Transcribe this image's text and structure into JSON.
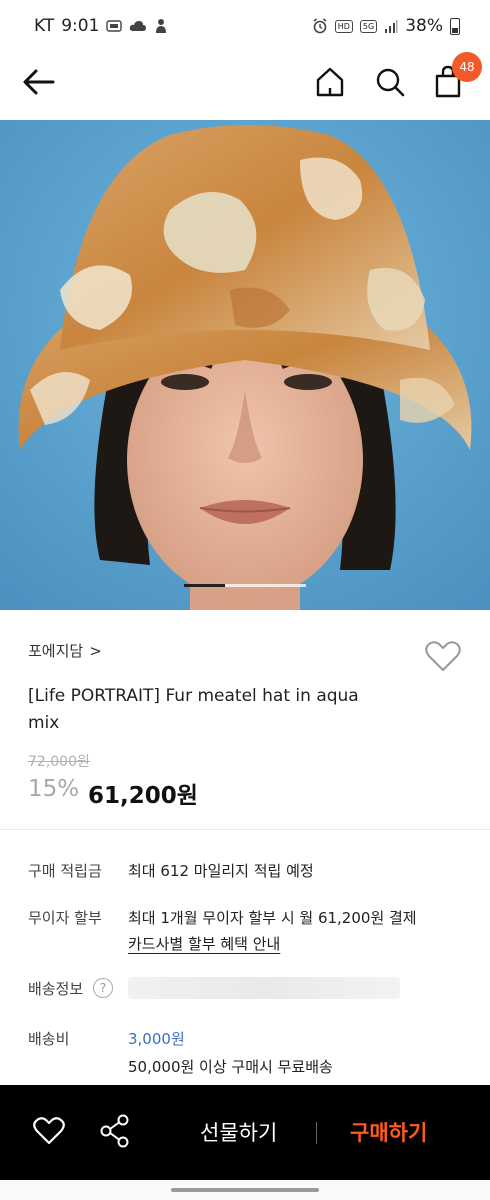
{
  "status_bar": {
    "carrier": "KT",
    "time": "9:01",
    "network": "5G",
    "hd_badge": "HD",
    "battery": "38%"
  },
  "header": {
    "cart_count": "48",
    "icons": [
      "back-arrow-icon",
      "home-icon",
      "search-icon",
      "shopping-bag-icon"
    ]
  },
  "product": {
    "image": "fur-bucket-hat-model-photo",
    "slide_position": 1,
    "slide_count": 3,
    "brand": "포에지담",
    "brand_chevron": ">",
    "title": "[Life PORTRAIT] Fur meatel hat in aqua mix",
    "original_price": "72,000원",
    "discount": "15%",
    "price": "61,200원"
  },
  "info": {
    "points_label": "구매 적립금",
    "points_value": "최대 612 마일리지 적립 예정",
    "installment_label": "무이자 할부",
    "installment_value": "최대 1개월 무이자 할부 시 월 61,200원 결제",
    "installment_link": "카드사별 할부 혜택 안내",
    "shipping_info_label": "배송정보",
    "help_symbol": "?",
    "shipping_fee_label": "배송비",
    "shipping_fee_value": "3,000원",
    "free_shipping_note": "50,000원 이상 구매시 무료배송"
  },
  "bottom_bar": {
    "gift_label": "선물하기",
    "buy_label": "구매하기"
  },
  "colors": {
    "accent": "#ff5a1f",
    "badge": "#f4592a",
    "link_blue": "#3b6ec8",
    "image_background": "#5aa3cf"
  }
}
